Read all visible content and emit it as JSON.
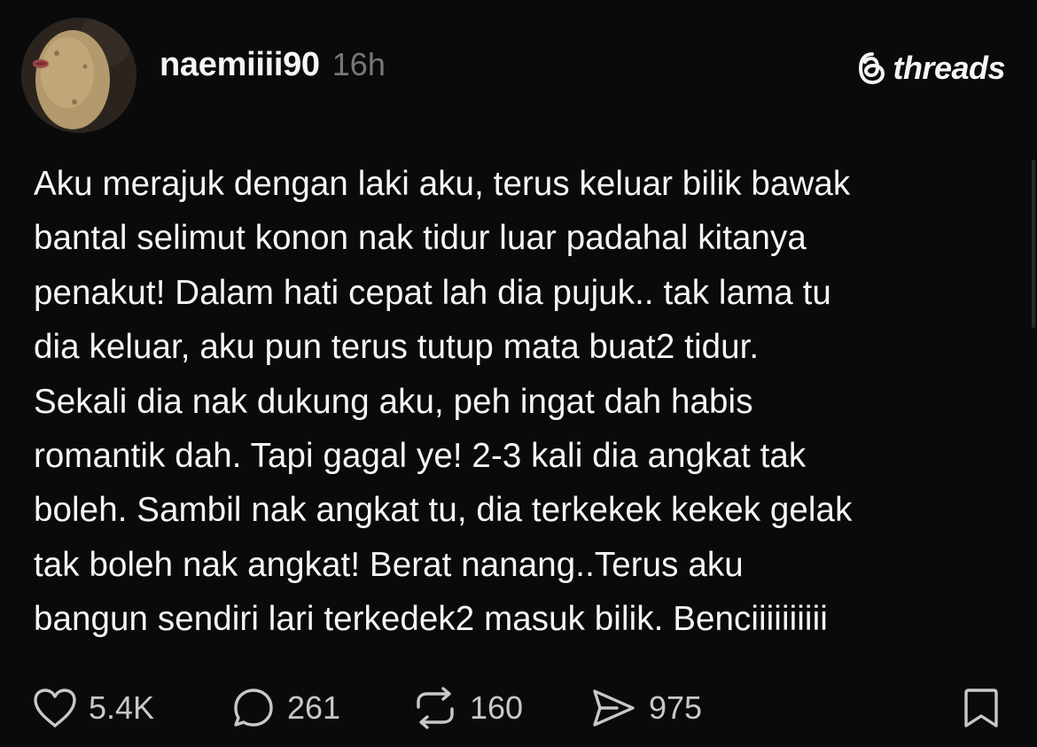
{
  "post": {
    "author": {
      "username": "naemiiii90",
      "timestamp": "16h"
    },
    "brand": {
      "name": "threads",
      "logo_icon": "threads-logo-icon"
    },
    "text": "Aku merajuk dengan laki aku, terus keluar bilik bawak\nbantal selimut konon nak tidur luar padahal kitanya\npenakut! Dalam hati cepat lah dia pujuk.. tak lama tu\ndia keluar, aku pun terus tutup mata buat2 tidur.\nSekali dia nak dukung aku, peh ingat dah habis\nromantik dah. Tapi gagal ye! 2-3 kali dia angkat tak\nboleh. Sambil nak angkat tu, dia terkekek kekek gelak\ntak boleh nak angkat! Berat nanang..Terus aku\nbangun sendiri lari terkedek2 masuk bilik. Benciiiiiiiiii",
    "actions": {
      "likes": "5.4K",
      "replies": "261",
      "reposts": "160",
      "shares": "975"
    }
  },
  "colors": {
    "background": "#0a0a0a",
    "text": "#f3f5f7",
    "muted": "#777777",
    "count": "#c8c8c8"
  },
  "icons": [
    "heart-icon",
    "comment-icon",
    "repost-icon",
    "share-icon",
    "bookmark-icon",
    "threads-logo-icon"
  ]
}
